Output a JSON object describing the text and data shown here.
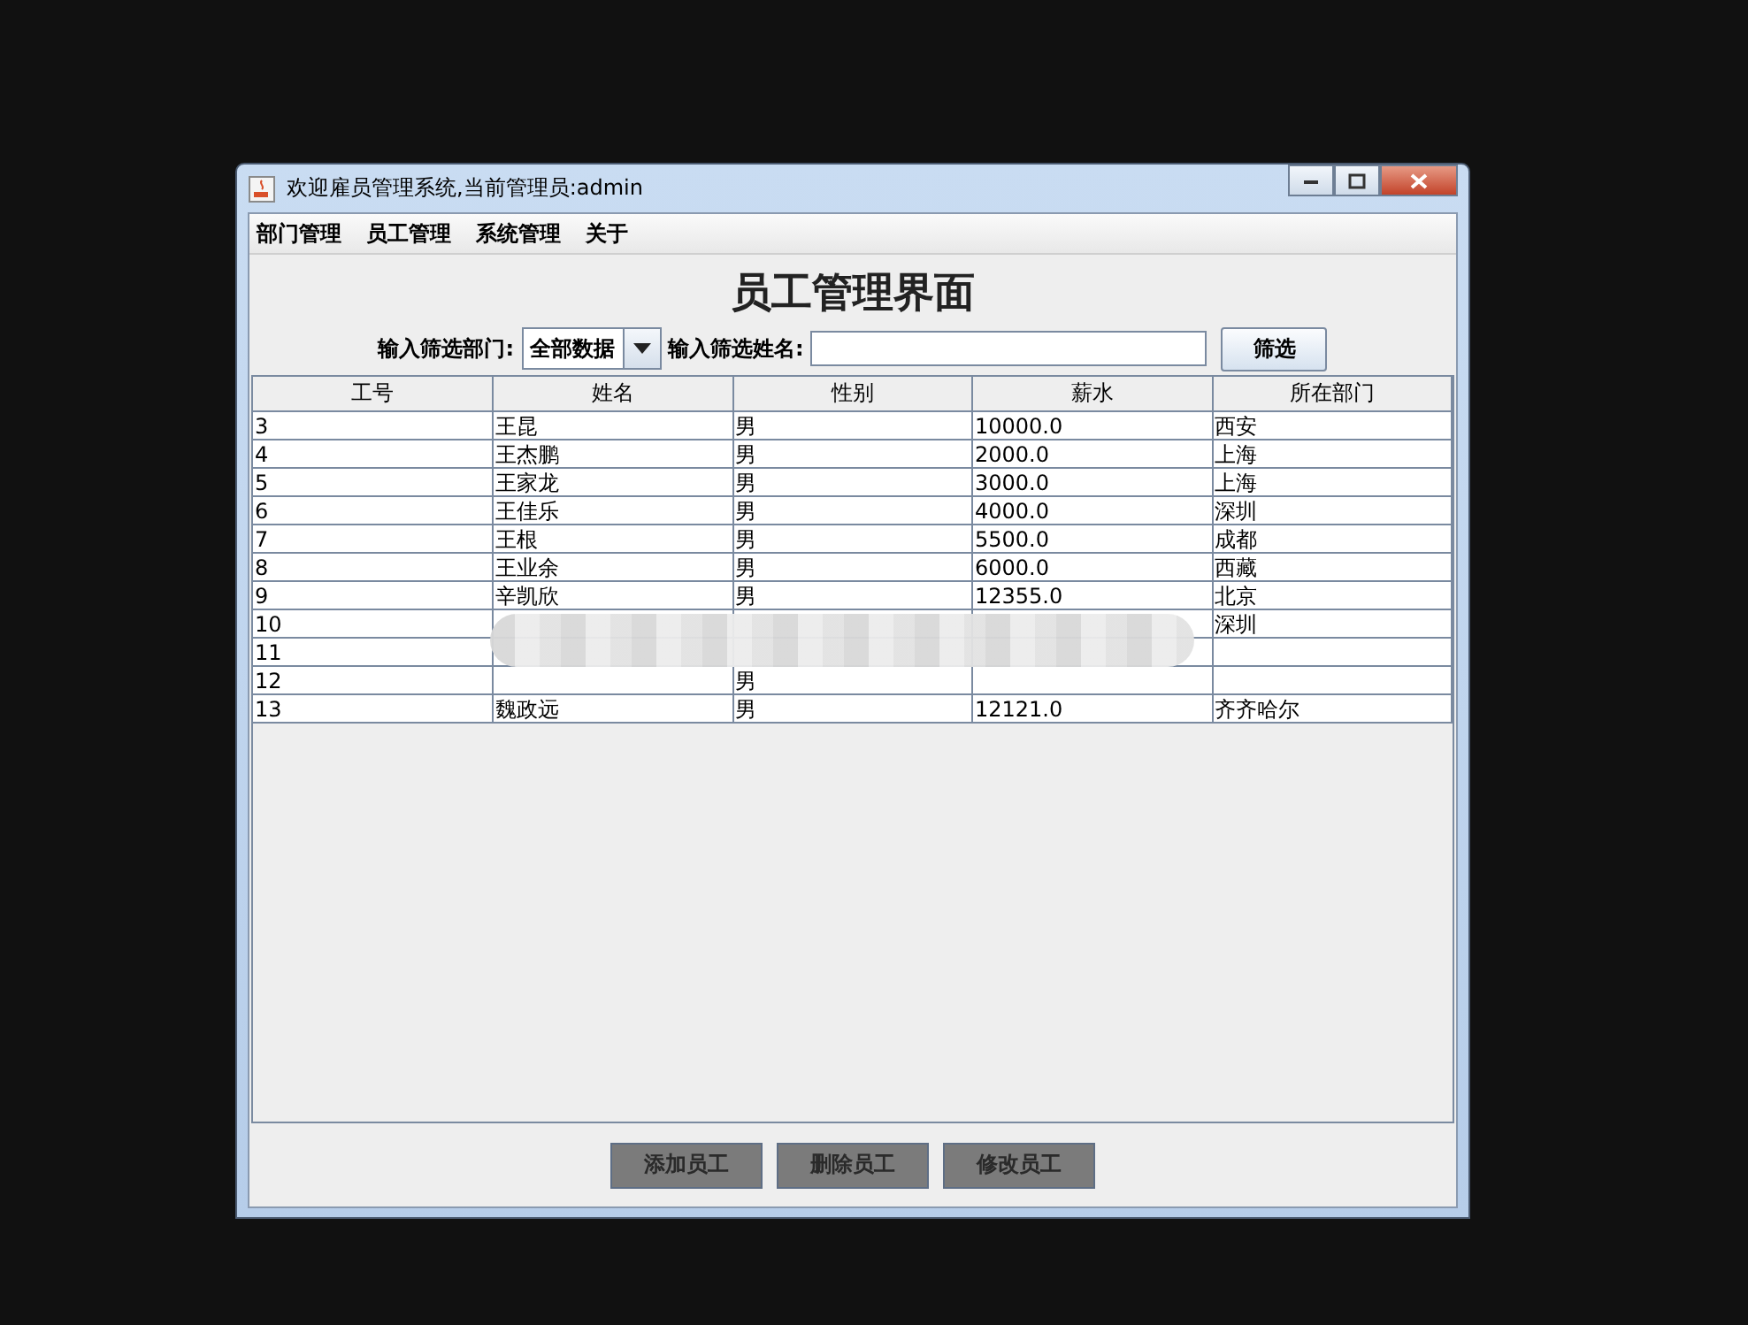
{
  "window": {
    "title": "欢迎雇员管理系统,当前管理员:admin"
  },
  "menu": [
    "部门管理",
    "员工管理",
    "系统管理",
    "关于"
  ],
  "heading": "员工管理界面",
  "filter": {
    "dept_label": "输入筛选部门:",
    "dept_value": "全部数据",
    "name_label": "输入筛选姓名:",
    "button": "筛选"
  },
  "table": {
    "columns": [
      "工号",
      "姓名",
      "性别",
      "薪水",
      "所在部门"
    ],
    "rows": [
      [
        "3",
        "王昆",
        "男",
        "10000.0",
        "西安"
      ],
      [
        "4",
        "王杰鹏",
        "男",
        "2000.0",
        "上海"
      ],
      [
        "5",
        "王家龙",
        "男",
        "3000.0",
        "上海"
      ],
      [
        "6",
        "王佳乐",
        "男",
        "4000.0",
        "深圳"
      ],
      [
        "7",
        "王根",
        "男",
        "5500.0",
        "成都"
      ],
      [
        "8",
        "王业余",
        "男",
        "6000.0",
        "西藏"
      ],
      [
        "9",
        "辛凯欣",
        "男",
        "12355.0",
        "北京"
      ],
      [
        "10",
        null,
        null,
        null,
        "深圳"
      ],
      [
        "11",
        null,
        null,
        null,
        null
      ],
      [
        "12",
        null,
        "男",
        null,
        null
      ],
      [
        "13",
        "魏政远",
        "男",
        "12121.0",
        "齐齐哈尔"
      ]
    ]
  },
  "buttons": [
    "添加员工",
    "删除员工",
    "修改员工"
  ]
}
